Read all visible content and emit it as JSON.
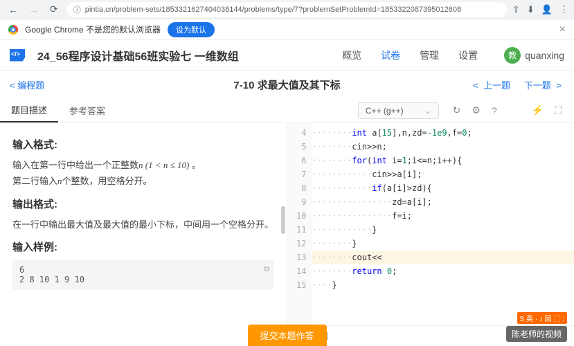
{
  "browser": {
    "url": "pintia.cn/problem-sets/1853321627404038144/problems/type/7?problemSetProblemId=1853322087395012608"
  },
  "infobar": {
    "text": "Google Chrome 不是您的默认浏览器",
    "button": "设为默认"
  },
  "header": {
    "title": "24_56程序设计基础56班实验七 一维数组",
    "tabs": {
      "overview": "概览",
      "exam": "试卷",
      "manage": "管理",
      "settings": "设置"
    },
    "avatar_text": "教",
    "username": "quanxing"
  },
  "subheader": {
    "breadcrumb": "编程题",
    "problem_title": "7-10 求最大值及其下标",
    "prev": "上一题",
    "next": "下一题"
  },
  "tabs": {
    "desc": "题目描述",
    "answer": "参考答案"
  },
  "editor": {
    "lang": "C++ (g++)",
    "test_cases": "测试用例"
  },
  "problem": {
    "input_fmt_h": "输入格式:",
    "input_fmt_p1": "输入在第一行中给出一个正整数",
    "input_fmt_math": "n  (1 < n ≤ 10)",
    "input_fmt_p1_end": " 。",
    "input_fmt_p2_a": "第二行输入",
    "input_fmt_p2_math": "n",
    "input_fmt_p2_b": "个整数，用空格分开。",
    "output_fmt_h": "输出格式:",
    "output_fmt_p": "在一行中输出最大值及最大值的最小下标，中间用一个空格分开。",
    "sample_in_h": "输入样例:",
    "sample_in_1": "6",
    "sample_in_2": "2 8 10 1 9 10"
  },
  "code_lines": [
    {
      "n": 4,
      "html": "<span class='dot'>········</span><span class='kw'>int</span> a[<span class='num'>15</span>],n,zd=<span class='num'>-1e9</span>,f=<span class='num'>0</span>;"
    },
    {
      "n": 5,
      "html": "<span class='dot'>········</span>cin>>n;"
    },
    {
      "n": 6,
      "html": "<span class='dot'>········</span><span class='kw'>for</span>(<span class='kw'>int</span> i=<span class='num'>1</span>;i<=n;i++){"
    },
    {
      "n": 7,
      "html": "<span class='dot'>············</span>cin>>a[i];"
    },
    {
      "n": 8,
      "html": "<span class='dot'>············</span><span class='kw'>if</span>(a[i]>zd){"
    },
    {
      "n": 9,
      "html": "<span class='dot'>················</span>zd=a[i];"
    },
    {
      "n": 10,
      "html": "<span class='dot'>················</span>f=i;"
    },
    {
      "n": 11,
      "html": "<span class='dot'>············</span>}"
    },
    {
      "n": 12,
      "html": "<span class='dot'>········</span>}"
    },
    {
      "n": 13,
      "html": "<span class='dot'>········</span>cout<<",
      "cursor": true
    },
    {
      "n": 14,
      "html": "<span class='dot'>········</span><span class='kw'>return</span> <span class='num'>0</span>;"
    },
    {
      "n": 15,
      "html": "<span class='dot'>····</span>}"
    }
  ],
  "submit": "提交本题作答",
  "watermark1": "S 英 · ♪ 回 ⬚ :",
  "watermark2": "陈老师的视频"
}
